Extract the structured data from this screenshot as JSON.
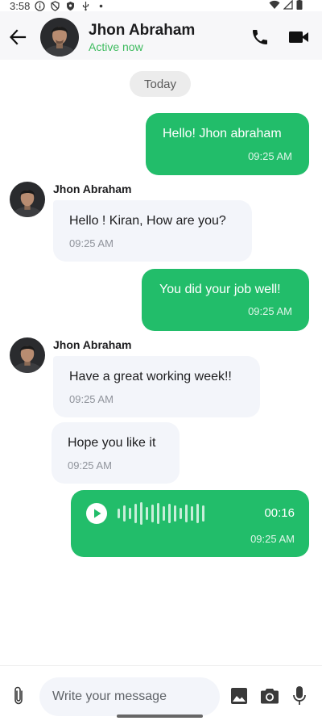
{
  "status_bar": {
    "time": "3:58",
    "icons": [
      "info-icon",
      "block-icon",
      "shield-icon",
      "usb-icon",
      "dot-icon"
    ],
    "right_icons": [
      "wifi-icon",
      "cell-signal-icon",
      "battery-icon"
    ]
  },
  "header": {
    "contact_name": "Jhon Abraham",
    "contact_status": "Active now",
    "icons": [
      "back-arrow-icon",
      "phone-icon",
      "video-camera-icon"
    ]
  },
  "chat": {
    "date_label": "Today",
    "messages": [
      {
        "direction": "outgoing",
        "type": "text",
        "text": "Hello! Jhon abraham",
        "time": "09:25 AM"
      },
      {
        "direction": "incoming",
        "type": "text",
        "sender": "Jhon Abraham",
        "text": "Hello ! Kiran, How are you?",
        "time": "09:25 AM"
      },
      {
        "direction": "outgoing",
        "type": "text",
        "text": "You did your job well!",
        "time": "09:25 AM"
      },
      {
        "direction": "incoming",
        "type": "text",
        "sender": "Jhon Abraham",
        "text": "Have a great working week!!",
        "time": "09:25 AM"
      },
      {
        "direction": "incoming",
        "type": "text",
        "text": "Hope you like it",
        "time": "09:25 AM"
      },
      {
        "direction": "outgoing",
        "type": "voice",
        "duration": "00:16",
        "time": "09:25 AM"
      }
    ]
  },
  "composer": {
    "placeholder": "Write your message",
    "icons": [
      "paperclip-icon",
      "image-icon",
      "camera-icon",
      "microphone-icon"
    ]
  },
  "colors": {
    "accent_green": "#22bd6a",
    "status_green": "#3dbb5e",
    "incoming_bubble": "#f3f5fa",
    "header_bg": "#f7f7f9"
  }
}
